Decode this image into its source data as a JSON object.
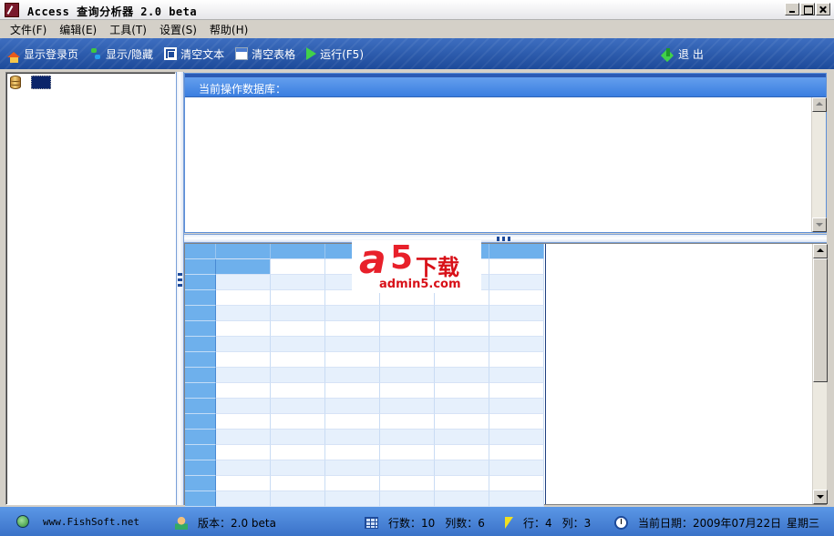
{
  "window": {
    "title": "Access 查询分析器 2.0 beta"
  },
  "menu": {
    "items": [
      "文件(F)",
      "编辑(E)",
      "工具(T)",
      "设置(S)",
      "帮助(H)"
    ]
  },
  "toolbar": {
    "show_login": "显示登录页",
    "show_hide": "显示/隐藏",
    "clear_text": "清空文本",
    "clear_table": "清空表格",
    "run": "运行(F5)",
    "exit": "退 出"
  },
  "query": {
    "current_db_label": "当前操作数据库："
  },
  "watermark": {
    "logo_a": "a",
    "logo_5": "5",
    "logo_cn": "下载",
    "logo_url": "admin5.com"
  },
  "grid": {
    "columns": 6,
    "visible_rows": 17,
    "current_row": 1,
    "current_col": 1
  },
  "status": {
    "website": "www.FishSoft.net",
    "version": "版本：2.0 beta",
    "rows": "行数：10",
    "cols": "列数：6",
    "cur_row": "行：4",
    "cur_col": "列：3",
    "date": "当前日期：2009年07月22日",
    "weekday": "星期三"
  },
  "icons": {
    "app": "access-app-icon",
    "home": "home-icon",
    "toggle": "toggle-icon",
    "clear_text": "clear-text-icon",
    "clear_table": "clear-table-icon",
    "run": "play-icon",
    "exit": "exit-icon",
    "database": "database-icon"
  },
  "colors": {
    "toolbar": "#1d4a9a",
    "grid_header": "#6eb0ec",
    "status_bar": "#3a72c8"
  }
}
